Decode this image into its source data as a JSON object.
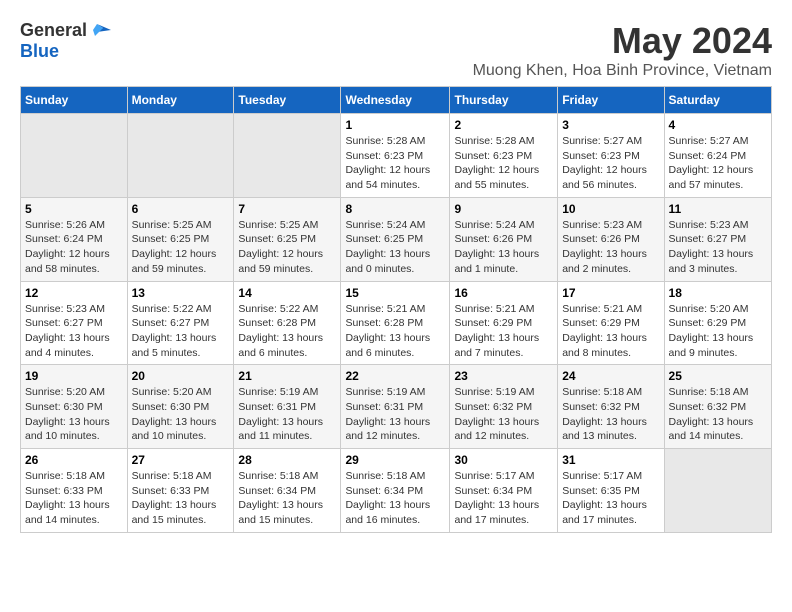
{
  "header": {
    "logo_general": "General",
    "logo_blue": "Blue",
    "month_title": "May 2024",
    "location": "Muong Khen, Hoa Binh Province, Vietnam"
  },
  "calendar": {
    "days_of_week": [
      "Sunday",
      "Monday",
      "Tuesday",
      "Wednesday",
      "Thursday",
      "Friday",
      "Saturday"
    ],
    "weeks": [
      [
        {
          "day": "",
          "info": ""
        },
        {
          "day": "",
          "info": ""
        },
        {
          "day": "",
          "info": ""
        },
        {
          "day": "1",
          "info": "Sunrise: 5:28 AM\nSunset: 6:23 PM\nDaylight: 12 hours\nand 54 minutes."
        },
        {
          "day": "2",
          "info": "Sunrise: 5:28 AM\nSunset: 6:23 PM\nDaylight: 12 hours\nand 55 minutes."
        },
        {
          "day": "3",
          "info": "Sunrise: 5:27 AM\nSunset: 6:23 PM\nDaylight: 12 hours\nand 56 minutes."
        },
        {
          "day": "4",
          "info": "Sunrise: 5:27 AM\nSunset: 6:24 PM\nDaylight: 12 hours\nand 57 minutes."
        }
      ],
      [
        {
          "day": "5",
          "info": "Sunrise: 5:26 AM\nSunset: 6:24 PM\nDaylight: 12 hours\nand 58 minutes."
        },
        {
          "day": "6",
          "info": "Sunrise: 5:25 AM\nSunset: 6:25 PM\nDaylight: 12 hours\nand 59 minutes."
        },
        {
          "day": "7",
          "info": "Sunrise: 5:25 AM\nSunset: 6:25 PM\nDaylight: 12 hours\nand 59 minutes."
        },
        {
          "day": "8",
          "info": "Sunrise: 5:24 AM\nSunset: 6:25 PM\nDaylight: 13 hours\nand 0 minutes."
        },
        {
          "day": "9",
          "info": "Sunrise: 5:24 AM\nSunset: 6:26 PM\nDaylight: 13 hours\nand 1 minute."
        },
        {
          "day": "10",
          "info": "Sunrise: 5:23 AM\nSunset: 6:26 PM\nDaylight: 13 hours\nand 2 minutes."
        },
        {
          "day": "11",
          "info": "Sunrise: 5:23 AM\nSunset: 6:27 PM\nDaylight: 13 hours\nand 3 minutes."
        }
      ],
      [
        {
          "day": "12",
          "info": "Sunrise: 5:23 AM\nSunset: 6:27 PM\nDaylight: 13 hours\nand 4 minutes."
        },
        {
          "day": "13",
          "info": "Sunrise: 5:22 AM\nSunset: 6:27 PM\nDaylight: 13 hours\nand 5 minutes."
        },
        {
          "day": "14",
          "info": "Sunrise: 5:22 AM\nSunset: 6:28 PM\nDaylight: 13 hours\nand 6 minutes."
        },
        {
          "day": "15",
          "info": "Sunrise: 5:21 AM\nSunset: 6:28 PM\nDaylight: 13 hours\nand 6 minutes."
        },
        {
          "day": "16",
          "info": "Sunrise: 5:21 AM\nSunset: 6:29 PM\nDaylight: 13 hours\nand 7 minutes."
        },
        {
          "day": "17",
          "info": "Sunrise: 5:21 AM\nSunset: 6:29 PM\nDaylight: 13 hours\nand 8 minutes."
        },
        {
          "day": "18",
          "info": "Sunrise: 5:20 AM\nSunset: 6:29 PM\nDaylight: 13 hours\nand 9 minutes."
        }
      ],
      [
        {
          "day": "19",
          "info": "Sunrise: 5:20 AM\nSunset: 6:30 PM\nDaylight: 13 hours\nand 10 minutes."
        },
        {
          "day": "20",
          "info": "Sunrise: 5:20 AM\nSunset: 6:30 PM\nDaylight: 13 hours\nand 10 minutes."
        },
        {
          "day": "21",
          "info": "Sunrise: 5:19 AM\nSunset: 6:31 PM\nDaylight: 13 hours\nand 11 minutes."
        },
        {
          "day": "22",
          "info": "Sunrise: 5:19 AM\nSunset: 6:31 PM\nDaylight: 13 hours\nand 12 minutes."
        },
        {
          "day": "23",
          "info": "Sunrise: 5:19 AM\nSunset: 6:32 PM\nDaylight: 13 hours\nand 12 minutes."
        },
        {
          "day": "24",
          "info": "Sunrise: 5:18 AM\nSunset: 6:32 PM\nDaylight: 13 hours\nand 13 minutes."
        },
        {
          "day": "25",
          "info": "Sunrise: 5:18 AM\nSunset: 6:32 PM\nDaylight: 13 hours\nand 14 minutes."
        }
      ],
      [
        {
          "day": "26",
          "info": "Sunrise: 5:18 AM\nSunset: 6:33 PM\nDaylight: 13 hours\nand 14 minutes."
        },
        {
          "day": "27",
          "info": "Sunrise: 5:18 AM\nSunset: 6:33 PM\nDaylight: 13 hours\nand 15 minutes."
        },
        {
          "day": "28",
          "info": "Sunrise: 5:18 AM\nSunset: 6:34 PM\nDaylight: 13 hours\nand 15 minutes."
        },
        {
          "day": "29",
          "info": "Sunrise: 5:18 AM\nSunset: 6:34 PM\nDaylight: 13 hours\nand 16 minutes."
        },
        {
          "day": "30",
          "info": "Sunrise: 5:17 AM\nSunset: 6:34 PM\nDaylight: 13 hours\nand 17 minutes."
        },
        {
          "day": "31",
          "info": "Sunrise: 5:17 AM\nSunset: 6:35 PM\nDaylight: 13 hours\nand 17 minutes."
        },
        {
          "day": "",
          "info": ""
        }
      ]
    ]
  }
}
